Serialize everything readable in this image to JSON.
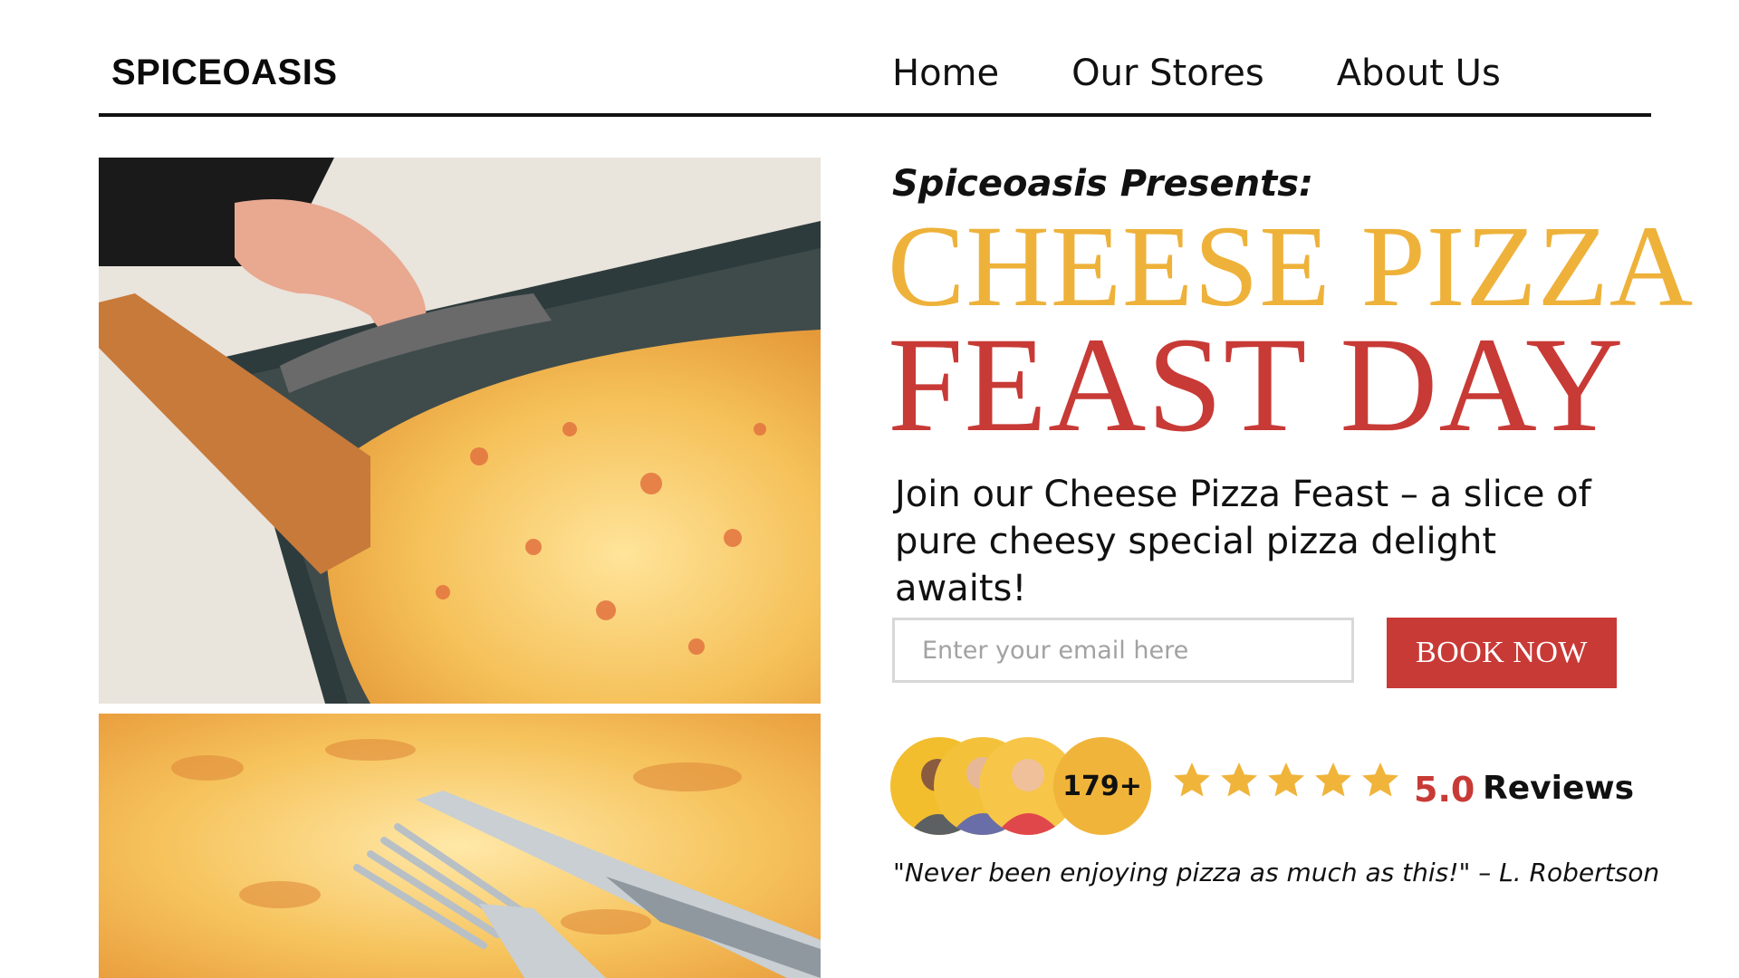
{
  "header": {
    "brand": "SPICEOASIS",
    "nav": [
      "Home",
      "Our Stores",
      "About Us"
    ]
  },
  "hero": {
    "presents": "Spiceoasis Presents:",
    "title_line1": "CHEESE PIZZA",
    "title_line2": "FEAST DAY",
    "description": "Join our Cheese Pizza Feast – a slice of pure cheesy special pizza delight awaits!"
  },
  "form": {
    "email_placeholder": "Enter your email here",
    "button_label": "BOOK NOW"
  },
  "reviews": {
    "count_badge": "179+",
    "stars": 5,
    "rating": "5.0",
    "label": "Reviews",
    "quote": "\"Never been enjoying pizza as much as this!\" – L. Robertson"
  },
  "colors": {
    "accent_yellow": "#eeb23a",
    "accent_red": "#c83a36",
    "text": "#111111"
  },
  "icons": {
    "star": "star-icon"
  }
}
